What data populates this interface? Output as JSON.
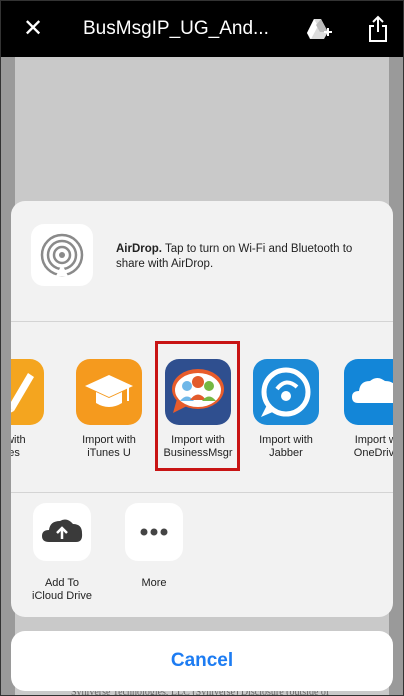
{
  "topbar": {
    "close_glyph": "✕",
    "title": "BusMsgIP_UG_And...",
    "drive_icon": "drive-add-icon",
    "share_icon": "share-icon"
  },
  "document": {
    "footer_text": "Syniverse Technologies, LLC (Syniverse) Disclosure (outside of"
  },
  "airdrop": {
    "icon": "airdrop-icon",
    "title": "AirDrop.",
    "message": " Tap to turn on Wi-Fi and Bluetooth to share with AirDrop."
  },
  "apps": [
    {
      "label_line1": "rt with",
      "label_line2": "ges",
      "icon": "pages-icon"
    },
    {
      "label_line1": "Import with",
      "label_line2": "iTunes U",
      "icon": "itunes-u-icon"
    },
    {
      "label_line1": "Import with",
      "label_line2": "BusinessMsgr",
      "icon": "businessmsgr-icon"
    },
    {
      "label_line1": "Import with",
      "label_line2": "Jabber",
      "icon": "jabber-icon"
    },
    {
      "label_line1": "Import wi",
      "label_line2": "OneDrive",
      "icon": "onedrive-icon"
    }
  ],
  "actions": [
    {
      "label_line1": "Add To",
      "label_line2": "iCloud Drive",
      "icon": "icloud-upload-icon"
    },
    {
      "label_line1": "More",
      "label_line2": "",
      "icon": "more-icon"
    }
  ],
  "cancel_label": "Cancel",
  "colors": {
    "accent_blue": "#1d7cf2",
    "highlight_red": "#c81414",
    "itunes_orange": "#f59a1e",
    "onedrive_blue": "#1386d8"
  }
}
